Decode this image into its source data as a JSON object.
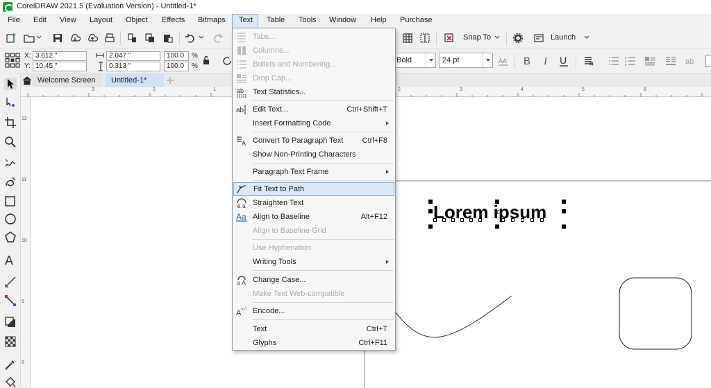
{
  "window": {
    "title": "CorelDRAW 2021.5 (Evaluation Version) - Untitled-1*"
  },
  "menubar": [
    {
      "label": "File"
    },
    {
      "label": "Edit"
    },
    {
      "label": "View"
    },
    {
      "label": "Layout"
    },
    {
      "label": "Object"
    },
    {
      "label": "Effects"
    },
    {
      "label": "Bitmaps"
    },
    {
      "label": "Text"
    },
    {
      "label": "Table"
    },
    {
      "label": "Tools"
    },
    {
      "label": "Window"
    },
    {
      "label": "Help"
    },
    {
      "label": "Purchase"
    }
  ],
  "toolbar": {
    "snap_to": "Snap To",
    "launch": "Launch"
  },
  "propertybar": {
    "x_label": "X:",
    "x_value": "3.612 \"",
    "y_label": "Y:",
    "y_value": "10.45 \"",
    "w_value": "2.047 \"",
    "h_value": "0.313 \"",
    "scale_x": "100.0",
    "scale_y": "100.0",
    "percent": "%",
    "font_style": "Bold",
    "font_size": "24 pt"
  },
  "tabs": [
    {
      "label": "Welcome Screen"
    },
    {
      "label": "Untitled-1*"
    }
  ],
  "ruler": {
    "h_ticks": [
      "3",
      "2",
      "1",
      "2",
      "3",
      "4",
      "5",
      "6"
    ],
    "v_ticks": [
      "12",
      "11",
      "10",
      "9",
      "8"
    ]
  },
  "canvas": {
    "text_object": "Lorem ipsum"
  },
  "text_menu": {
    "items": [
      {
        "label": "Tabs...",
        "shortcut": "",
        "disabled": true,
        "submenu": false,
        "icon": "tabs-icon"
      },
      {
        "label": "Columns...",
        "shortcut": "",
        "disabled": true,
        "submenu": false,
        "icon": "columns-icon"
      },
      {
        "label": "Bullets and Numbering...",
        "shortcut": "",
        "disabled": true,
        "submenu": false,
        "icon": "bullets-icon"
      },
      {
        "label": "Drop Cap...",
        "shortcut": "",
        "disabled": true,
        "submenu": false,
        "icon": "drop-cap-icon"
      },
      {
        "label": "Text Statistics...",
        "shortcut": "",
        "disabled": false,
        "submenu": false,
        "icon": "text-statistics-icon"
      },
      {
        "label": "Edit Text...",
        "shortcut": "Ctrl+Shift+T",
        "disabled": false,
        "submenu": false,
        "icon": "edit-text-icon"
      },
      {
        "label": "Insert Formatting Code",
        "shortcut": "",
        "disabled": false,
        "submenu": true,
        "icon": ""
      },
      {
        "label": "Convert To Paragraph Text",
        "shortcut": "Ctrl+F8",
        "disabled": false,
        "submenu": false,
        "icon": "convert-text-icon"
      },
      {
        "label": "Show Non-Printing Characters",
        "shortcut": "",
        "disabled": false,
        "submenu": false,
        "icon": ""
      },
      {
        "label": "Paragraph Text Frame",
        "shortcut": "",
        "disabled": false,
        "submenu": true,
        "icon": ""
      },
      {
        "label": "Fit Text to Path",
        "shortcut": "",
        "disabled": false,
        "submenu": false,
        "icon": "fit-text-path-icon",
        "highlighted": true
      },
      {
        "label": "Straighten Text",
        "shortcut": "",
        "disabled": false,
        "submenu": false,
        "icon": "straighten-text-icon"
      },
      {
        "label": "Align to Baseline",
        "shortcut": "Alt+F12",
        "disabled": false,
        "submenu": false,
        "icon": "align-baseline-icon"
      },
      {
        "label": "Align to Baseline Grid",
        "shortcut": "",
        "disabled": true,
        "submenu": false,
        "icon": ""
      },
      {
        "label": "Use Hyphenation",
        "shortcut": "",
        "disabled": true,
        "submenu": false,
        "icon": ""
      },
      {
        "label": "Writing Tools",
        "shortcut": "",
        "disabled": false,
        "submenu": true,
        "icon": ""
      },
      {
        "label": "Change Case...",
        "shortcut": "",
        "disabled": false,
        "submenu": false,
        "icon": "change-case-icon"
      },
      {
        "label": "Make Text Web-compatible",
        "shortcut": "",
        "disabled": true,
        "submenu": false,
        "icon": ""
      },
      {
        "label": "Encode...",
        "shortcut": "",
        "disabled": false,
        "submenu": false,
        "icon": "encode-icon"
      },
      {
        "label": "Text",
        "shortcut": "Ctrl+T",
        "disabled": false,
        "submenu": false,
        "icon": ""
      },
      {
        "label": "Glyphs",
        "shortcut": "Ctrl+F11",
        "disabled": false,
        "submenu": false,
        "icon": ""
      }
    ]
  },
  "colors": {
    "menu_highlight": "#dbe9f7",
    "highlight_border": "#7fa9d6",
    "menubar_bg": "#f0f0f0",
    "logo": "#1a9a3c"
  }
}
